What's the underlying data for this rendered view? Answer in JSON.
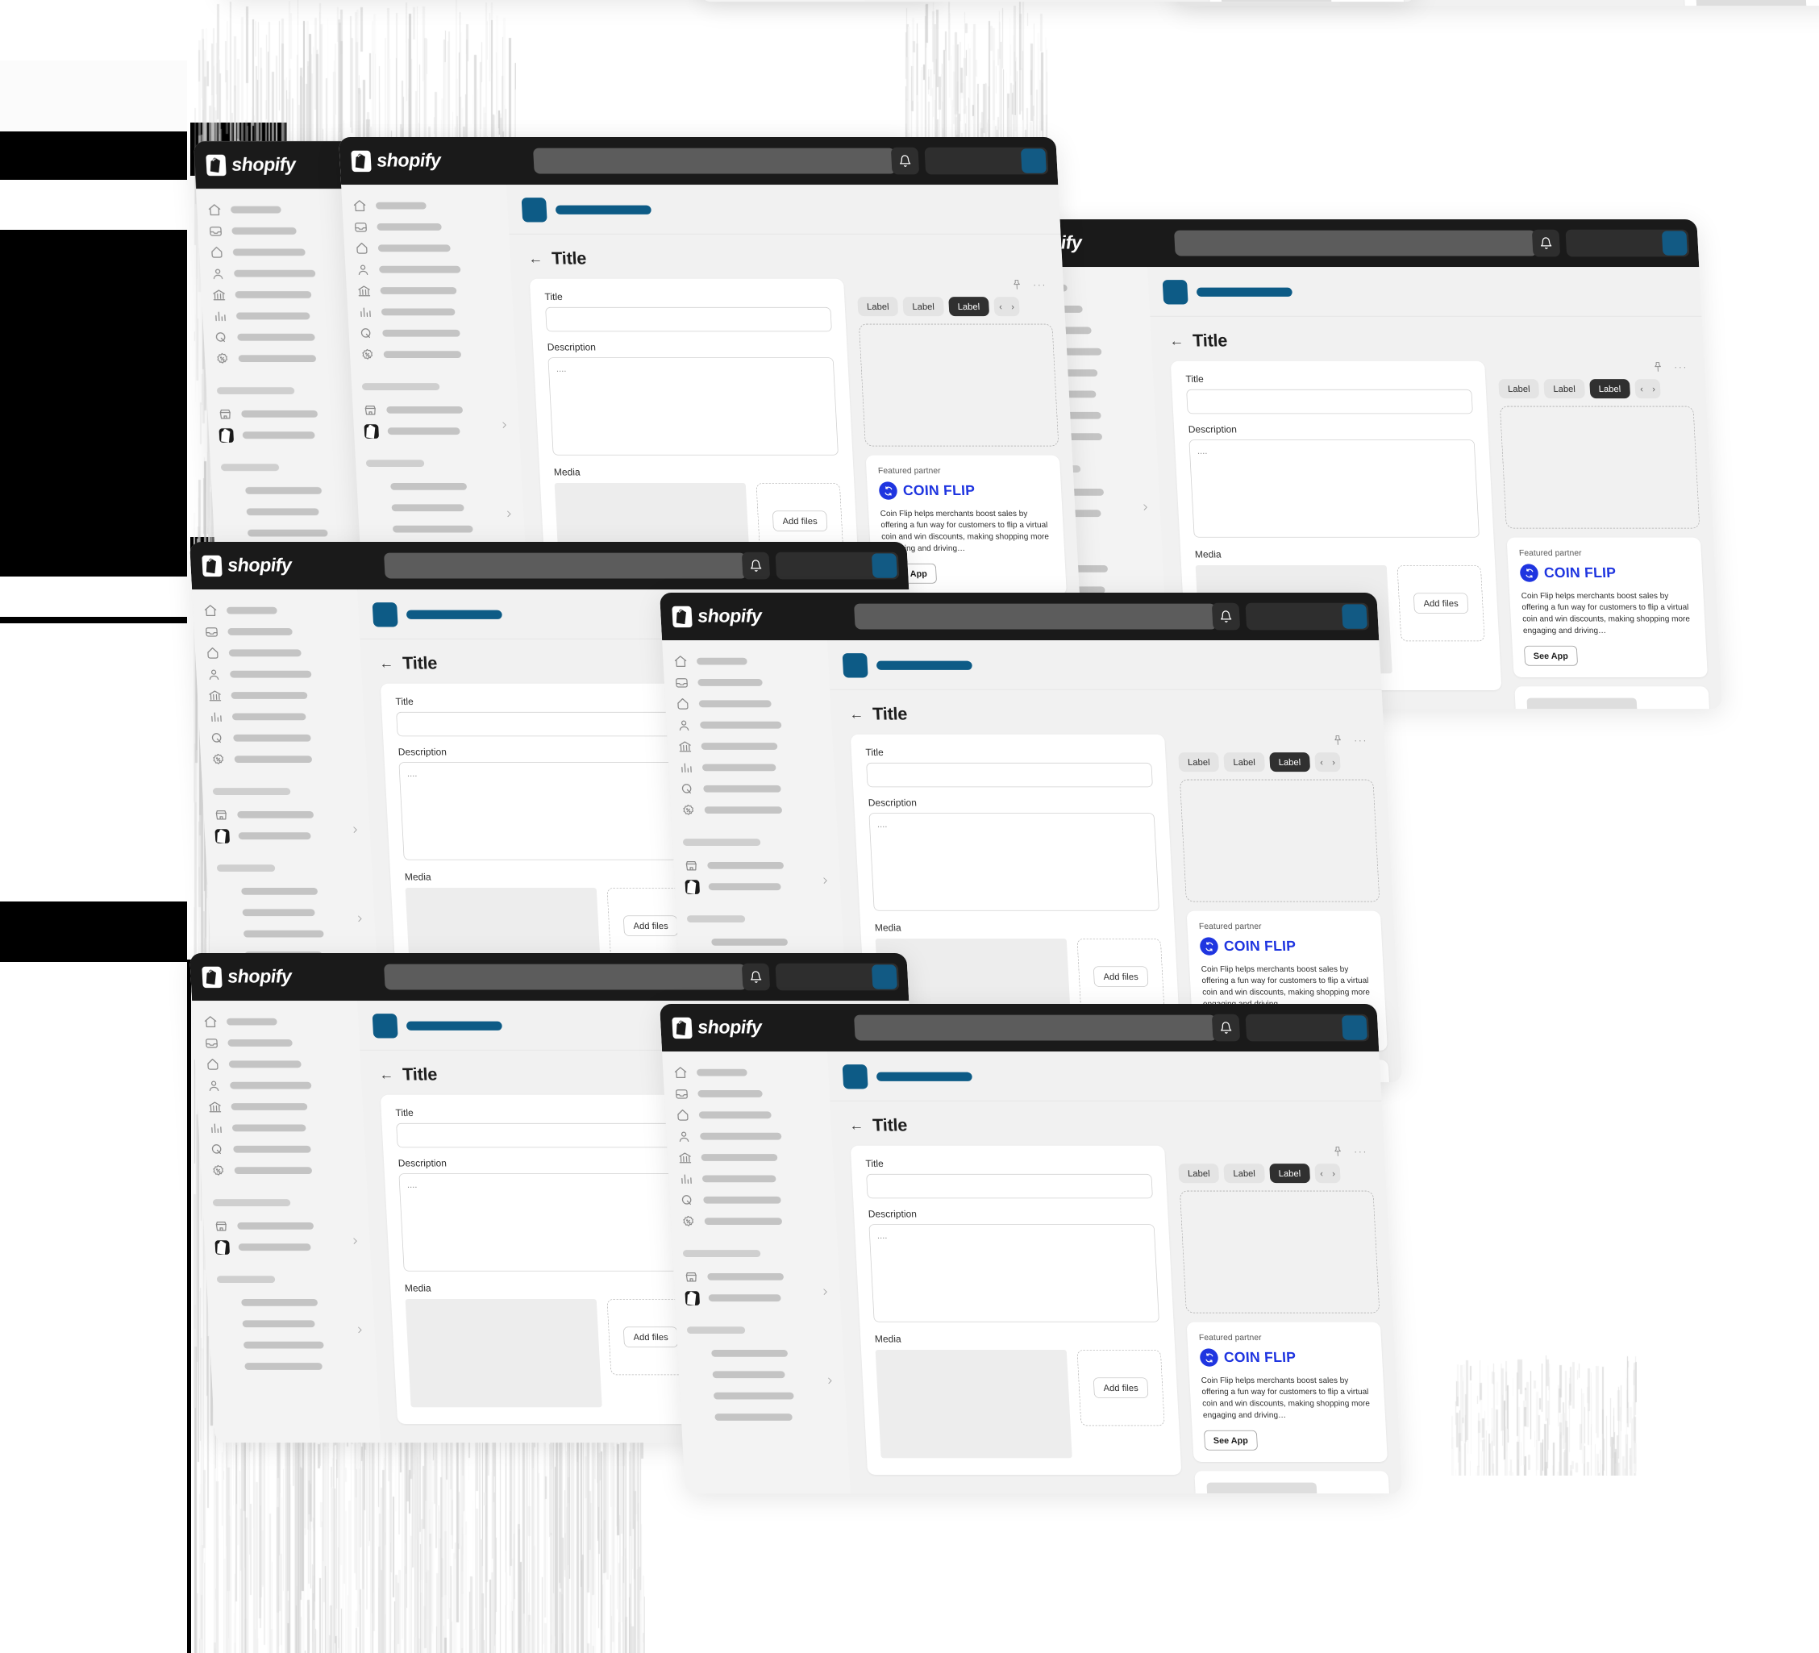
{
  "app": {
    "brand": "shopify",
    "accent_blue": "#0d5b86",
    "topbar_bg": "#1a1a1a",
    "coinflip_blue": "#1f35e0"
  },
  "topbar": {
    "logo_label": "shopify",
    "search_placeholder": "",
    "bell_icon": "bell-icon",
    "avatar_label": ""
  },
  "sidebar": {
    "items": [
      {
        "icon": "home-icon",
        "label": ""
      },
      {
        "icon": "orders-icon",
        "label": ""
      },
      {
        "icon": "products-icon",
        "label": ""
      },
      {
        "icon": "customers-icon",
        "label": ""
      },
      {
        "icon": "finance-icon",
        "label": ""
      },
      {
        "icon": "analytics-icon",
        "label": ""
      },
      {
        "icon": "marketing-icon",
        "label": ""
      },
      {
        "icon": "discounts-icon",
        "label": ""
      }
    ],
    "group_label": "",
    "channels": [
      {
        "icon": "online-store-icon",
        "label": ""
      },
      {
        "icon": "shop-icon",
        "label": ""
      }
    ],
    "apps": [
      {
        "label": ""
      },
      {
        "label": ""
      },
      {
        "label": ""
      },
      {
        "label": ""
      }
    ]
  },
  "page": {
    "back_icon": "arrow-left-icon",
    "title": "Title"
  },
  "form": {
    "title_label": "Title",
    "title_value": "",
    "description_label": "Description",
    "description_value": "....",
    "media_label": "Media",
    "add_files_label": "Add files"
  },
  "panel": {
    "pin_icon": "pin-icon",
    "more_icon": "more-horizontal-icon",
    "tabs": [
      {
        "label": "Label",
        "active": false
      },
      {
        "label": "Label",
        "active": false
      },
      {
        "label": "Label",
        "active": true
      }
    ],
    "pager": {
      "prev": "‹",
      "next": "›"
    }
  },
  "partner": {
    "eyebrow": "Featured partner",
    "logo_icon": "coin-flip-icon",
    "name": "COIN FLIP",
    "description": "Coin Flip helps merchants boost sales by offering a fun way for customers to flip a virtual coin and win discounts, making shopping more engaging and driving…",
    "cta": "See App"
  }
}
